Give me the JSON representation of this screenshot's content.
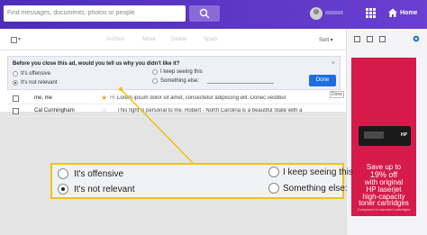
{
  "header": {
    "search_placeholder": "Find messages, documents, photos or people",
    "home_label": "Home"
  },
  "toolbar": {
    "archive": "Archive",
    "move": "Move",
    "delete": "Delete",
    "spam": "Spam",
    "sort": "Sort"
  },
  "feedback": {
    "question": "Before you close this ad, would you tell us why you didn't like it?",
    "close": "×",
    "options": [
      {
        "label": "It's offensive",
        "selected": false
      },
      {
        "label": "It's not relevant",
        "selected": true
      },
      {
        "label": "I keep seeing this",
        "selected": false
      },
      {
        "label": "Something else:",
        "selected": false
      }
    ],
    "done": "Done",
    "done_tooltip": "Done"
  },
  "emails": [
    {
      "from": "me, me",
      "starred": true,
      "prefix": "Hi",
      "subject": "Lorem ipsum dolor sit amet, consectetur adipiscing elit. Donec vestibul"
    },
    {
      "from": "Cal Cunningham",
      "starred": false,
      "prefix": "",
      "subject": "This fight is personal to me.  Robert - North Carolina is a beautiful State with a"
    }
  ],
  "zoom": {
    "options": [
      {
        "label": "It's offensive",
        "selected": false
      },
      {
        "label": "It's not relevant",
        "selected": true
      },
      {
        "label": "I keep seeing this",
        "selected": false
      },
      {
        "label": "Something else:",
        "selected": false
      }
    ]
  },
  "ad": {
    "line1": "Save up to",
    "line2": "19% off",
    "line3": "with original",
    "line4": "HP laserjet",
    "line5": "high-capacity",
    "line6": "toner cartridges",
    "fine_print": "Compared to standard cartridges",
    "cartridge_label": "HP"
  },
  "colors": {
    "header_purple": "#5e36c4",
    "ad_red": "#d61b4a",
    "done_blue": "#1c6fe0",
    "callout_yellow": "#f0c21a"
  }
}
